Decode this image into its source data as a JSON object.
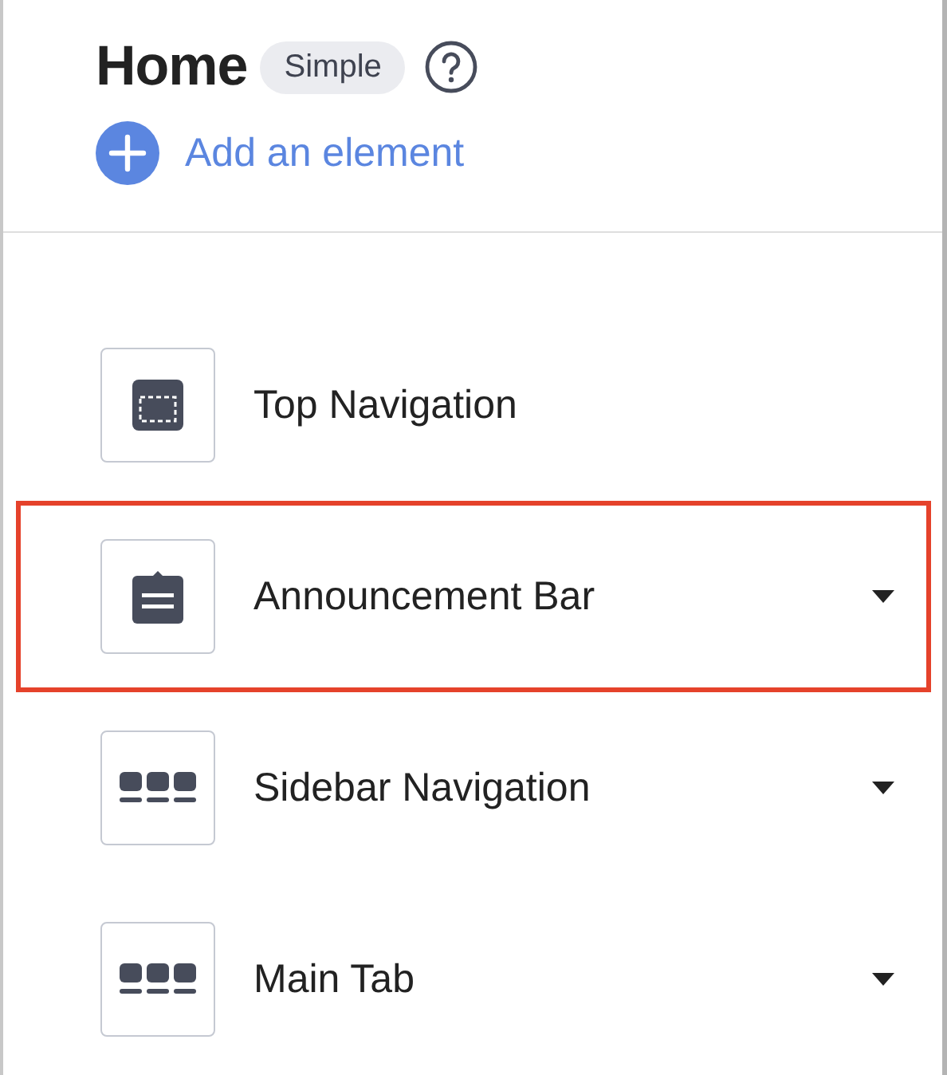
{
  "header": {
    "title": "Home",
    "badge": "Simple",
    "add_link": "Add an element"
  },
  "elements": [
    {
      "label": "Top Navigation",
      "kind": "top-nav",
      "highlighted": false,
      "has_caret": false
    },
    {
      "label": "Announcement Bar",
      "kind": "announcement",
      "highlighted": true,
      "has_caret": true
    },
    {
      "label": "Sidebar Navigation",
      "kind": "tabs",
      "highlighted": false,
      "has_caret": true
    },
    {
      "label": "Main Tab",
      "kind": "tabs",
      "highlighted": false,
      "has_caret": true
    }
  ]
}
